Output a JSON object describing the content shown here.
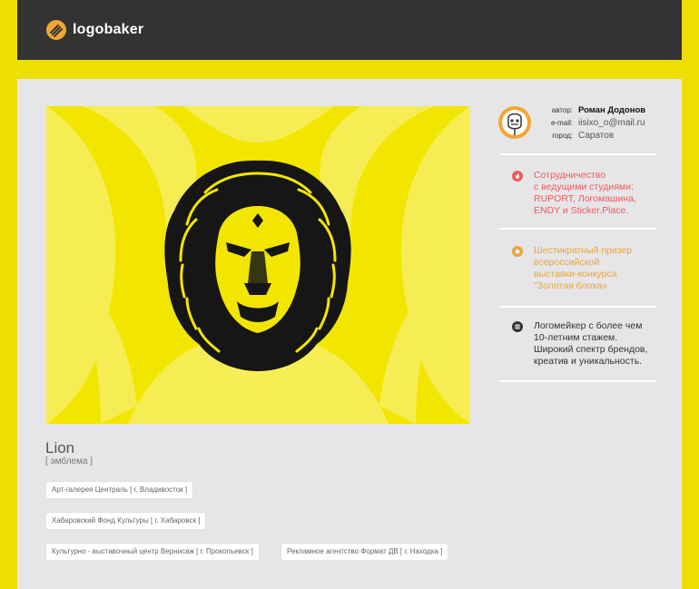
{
  "header": {
    "brand": "logobaker"
  },
  "work": {
    "title": "Lion",
    "subtitle": "[ эмблема ]",
    "tags": [
      "Арт-галерея Централь [ г. Владивосток ]",
      "Хабаровский Фонд Культуры [ г. Хабаровск ]",
      "Культурно - выставочный центр Вернисаж [ г. Прокопьевск ]",
      "Рекламное агентство Формат ДВ [ г. Находка ]"
    ]
  },
  "author": {
    "label_author": "автор:",
    "name": "Роман Додонов",
    "label_email": "e-mail:",
    "email": "iisixo_o@mail.ru",
    "label_city": "город:",
    "city": "Саратов"
  },
  "highlights": [
    {
      "icon": "fire-icon",
      "color": "#f0595a",
      "lines": [
        "Сотрудничество",
        "с ведущими студиями:",
        "RUPORT, Логомашина,",
        "ENDY и Sticker.Place."
      ]
    },
    {
      "icon": "star-icon",
      "color": "#e9a63a",
      "lines": [
        "Шестикратный призер",
        "всероссийской",
        "выставки-конкурса",
        "\"Золотая блоха»"
      ]
    },
    {
      "icon": "list-icon",
      "color": "#333333",
      "lines": [
        "Логомейкер с более чем",
        "10-летним стажем.",
        "Широкий спектр брендов,",
        "креатив и уникальность."
      ]
    }
  ],
  "colors": {
    "accent_yellow": "#ede000",
    "header_bg": "#333333",
    "panel_bg": "#e6e5e8",
    "logo_orange": "#f0a630"
  }
}
